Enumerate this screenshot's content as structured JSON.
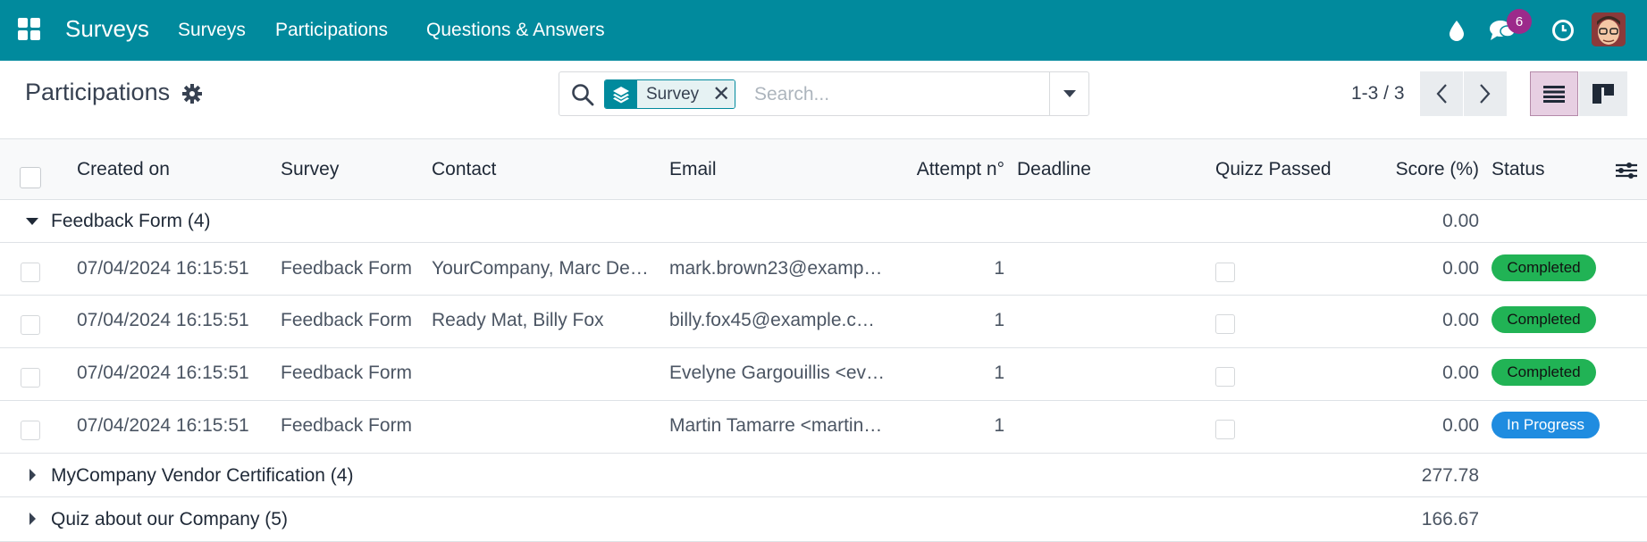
{
  "navbar": {
    "brand": "Surveys",
    "menu": [
      "Surveys",
      "Participations",
      "Questions & Answers"
    ],
    "messages_count": "6",
    "bg_color": "#018a9d"
  },
  "control_panel": {
    "title": "Participations",
    "search": {
      "facet_label": "Survey",
      "placeholder": "Search..."
    },
    "pager": "1-3 / 3"
  },
  "table": {
    "columns": [
      "Created on",
      "Survey",
      "Contact",
      "Email",
      "Attempt n°",
      "Deadline",
      "Quizz Passed",
      "Score (%)",
      "Status"
    ],
    "groups": [
      {
        "label": "Feedback Form (4)",
        "score": "0.00",
        "expanded": true,
        "rows": [
          {
            "created_on": "07/04/2024 16:15:51",
            "survey": "Feedback Form",
            "contact": "YourCompany, Marc De…",
            "email": "mark.brown23@examp…",
            "attempt": "1",
            "deadline": "",
            "score": "0.00",
            "status": "Completed"
          },
          {
            "created_on": "07/04/2024 16:15:51",
            "survey": "Feedback Form",
            "contact": "Ready Mat, Billy Fox",
            "email": "billy.fox45@example.c…",
            "attempt": "1",
            "deadline": "",
            "score": "0.00",
            "status": "Completed"
          },
          {
            "created_on": "07/04/2024 16:15:51",
            "survey": "Feedback Form",
            "contact": "",
            "email": "Evelyne Gargouillis <ev…",
            "attempt": "1",
            "deadline": "",
            "score": "0.00",
            "status": "Completed"
          },
          {
            "created_on": "07/04/2024 16:15:51",
            "survey": "Feedback Form",
            "contact": "",
            "email": "Martin Tamarre <martin…",
            "attempt": "1",
            "deadline": "",
            "score": "0.00",
            "status": "In Progress"
          }
        ]
      },
      {
        "label": "MyCompany Vendor Certification (4)",
        "score": "277.78",
        "expanded": false
      },
      {
        "label": "Quiz about our Company (5)",
        "score": "166.67",
        "expanded": false
      }
    ]
  },
  "colors": {
    "status_completed": "#21b355",
    "status_in_progress": "#1f8ce0",
    "badge": "#9c2a8b"
  }
}
